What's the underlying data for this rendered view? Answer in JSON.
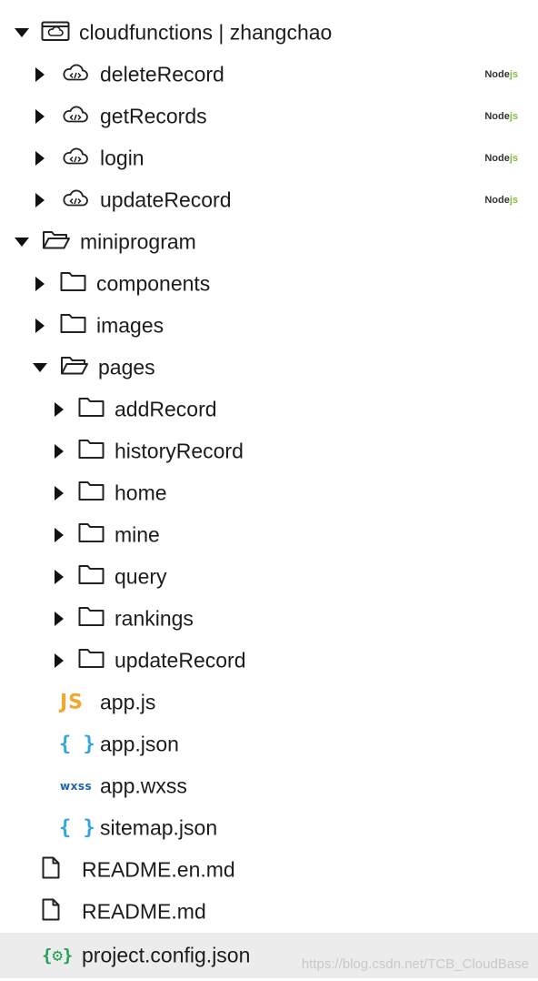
{
  "explorer": {
    "cloudfunctions": {
      "label": "cloudfunctions | zhangchao",
      "runtime_badge": {
        "prefix": "Node",
        "suffix": "js"
      },
      "children": [
        "deleteRecord",
        "getRecords",
        "login",
        "updateRecord"
      ]
    },
    "miniprogram": {
      "label": "miniprogram",
      "components": "components",
      "images": "images",
      "pages": {
        "label": "pages",
        "children": [
          "addRecord",
          "historyRecord",
          "home",
          "mine",
          "query",
          "rankings",
          "updateRecord"
        ]
      },
      "files": {
        "app_js": "app.js",
        "app_json": "app.json",
        "app_wxss": "app.wxss",
        "sitemap_json": "sitemap.json"
      },
      "icon_text": {
        "js": "JS",
        "json": "{ }",
        "wxss": "wxss",
        "config": "{⚙}"
      }
    },
    "root_files": {
      "readme_en": "README.en.md",
      "readme": "README.md",
      "project_config": "project.config.json"
    }
  },
  "watermark": "https://blog.csdn.net/TCB_CloudBase",
  "colors": {
    "selected_row": "#ececec",
    "nodejs_green": "#7fbf3f",
    "js_icon": "#f0a830",
    "json_icon": "#33a6e0",
    "wxss_icon": "#1f64b0",
    "config_icon": "#23a05a"
  }
}
